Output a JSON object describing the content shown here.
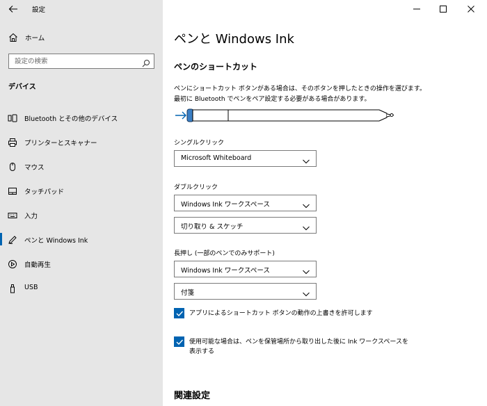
{
  "app": {
    "title": "設定"
  },
  "sidebar": {
    "home_label": "ホーム",
    "search_placeholder": "設定の検索",
    "section_heading": "デバイス",
    "items": [
      {
        "label": "Bluetooth とその他のデバイス",
        "icon": "bluetooth-devices-icon"
      },
      {
        "label": "プリンターとスキャナー",
        "icon": "printer-icon"
      },
      {
        "label": "マウス",
        "icon": "mouse-icon"
      },
      {
        "label": "タッチパッド",
        "icon": "touchpad-icon"
      },
      {
        "label": "入力",
        "icon": "keyboard-icon"
      },
      {
        "label": "ペンと Windows Ink",
        "icon": "pen-icon",
        "selected": true
      },
      {
        "label": "自動再生",
        "icon": "autoplay-icon"
      },
      {
        "label": "USB",
        "icon": "usb-icon"
      }
    ]
  },
  "main": {
    "title": "ペンと Windows Ink",
    "shortcut_heading": "ペンのショートカット",
    "description_line1": "ペンにショートカット ボタンがある場合は、そのボタンを押したときの操作を選びます。",
    "description_line2": "最初に Bluetooth でペンをペア設定する必要がある場合があります。",
    "single_click": {
      "label": "シングルクリック",
      "value": "Microsoft Whiteboard"
    },
    "double_click": {
      "label": "ダブルクリック",
      "value1": "Windows Ink ワークスペース",
      "value2": "切り取り & スケッチ"
    },
    "long_press": {
      "label": "長押し (一部のペンでのみサポート)",
      "value1": "Windows Ink ワークスペース",
      "value2": "付箋"
    },
    "checkbox1": {
      "label": "アプリによるショートカット ボタンの動作の上書きを許可します",
      "checked": true
    },
    "checkbox2": {
      "label": "使用可能な場合は、ペンを保管場所から取り出した後に Ink ワークスペースを表示する",
      "checked": true
    },
    "related_heading": "関連設定"
  },
  "colors": {
    "accent": "#0063b1",
    "sidebar_bg": "#e6e6e6"
  }
}
